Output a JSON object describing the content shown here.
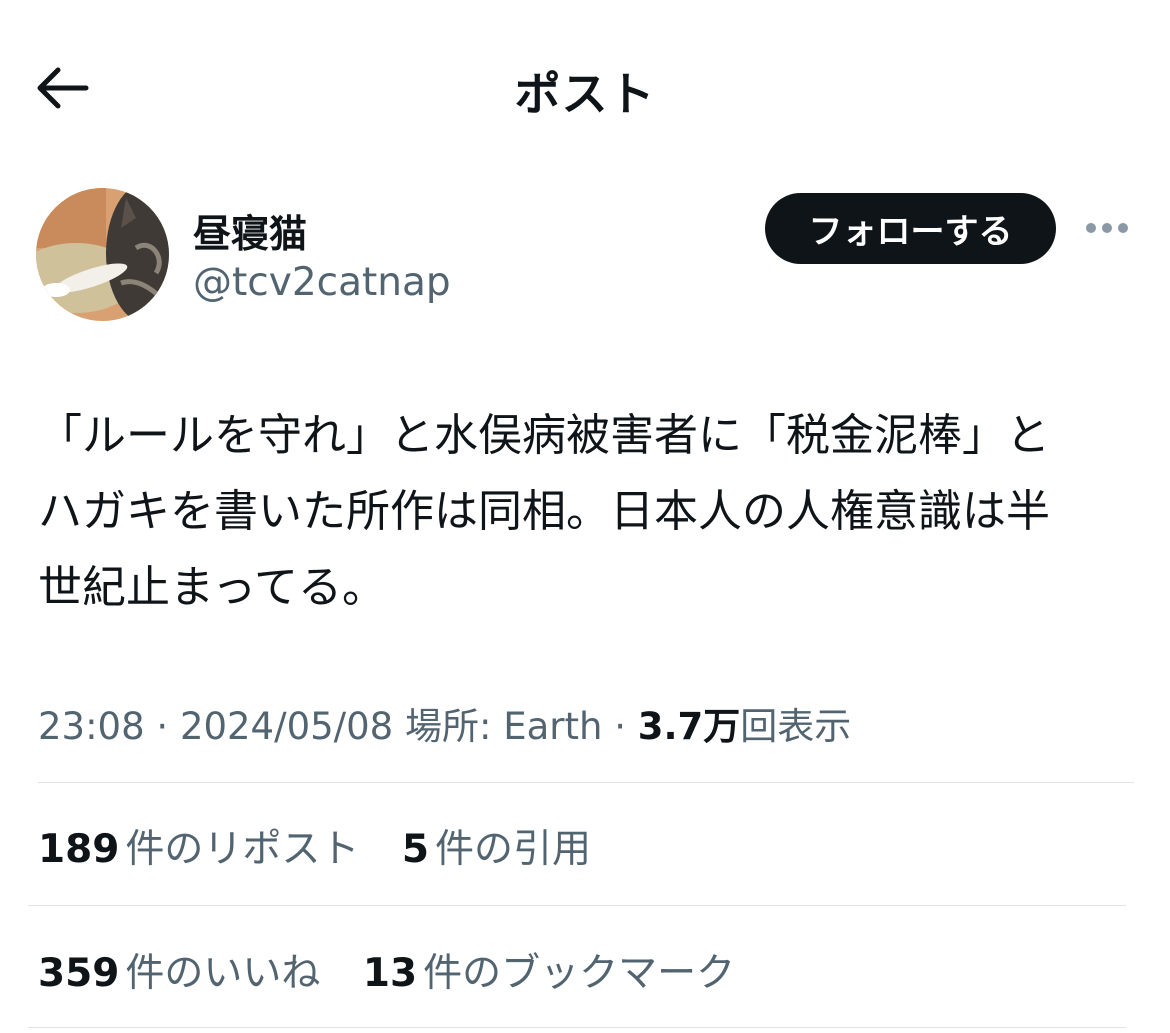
{
  "header": {
    "title": "ポスト"
  },
  "author": {
    "display_name": "昼寝猫",
    "handle": "@tcv2catnap",
    "follow_label": "フォローする"
  },
  "post": {
    "lines": [
      "「ルールを守れ」と水俣病被害者に「税金泥棒」と",
      "ハガキを書いた所作は同相。日本人の人権意識は半",
      "世紀止まってる。"
    ]
  },
  "meta": {
    "time": "23:08",
    "sep1": "·",
    "date": "2024/05/08",
    "location": "場所: Earth",
    "sep2": "·",
    "views_count": "3.7万",
    "views_label": "回表示"
  },
  "stats": {
    "reposts": {
      "count": "189",
      "label": "件のリポスト"
    },
    "quotes": {
      "count": "5",
      "label": "件の引用"
    },
    "likes": {
      "count": "359",
      "label": "件のいいね"
    },
    "bookmarks": {
      "count": "13",
      "label": "件のブックマーク"
    }
  },
  "colors": {
    "text_primary": "#0f1419",
    "text_secondary": "#536471",
    "divider": "#dfe3e6",
    "follow_bg": "#0f1419",
    "follow_text": "#ffffff"
  },
  "icons": {
    "back": "arrow-left-icon",
    "more": "more-horizontal-icon"
  }
}
